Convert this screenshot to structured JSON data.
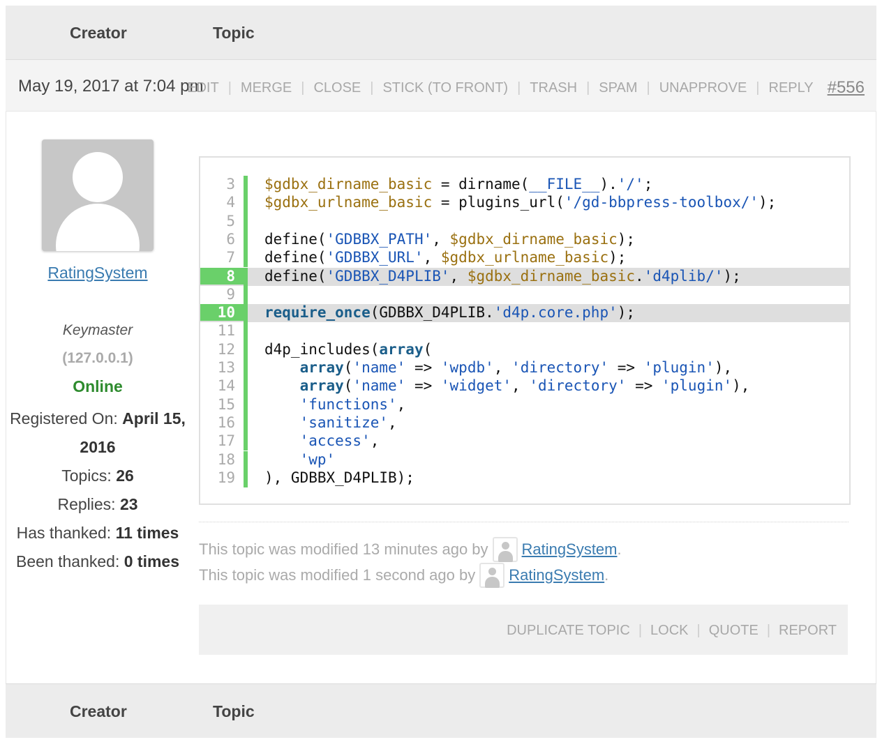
{
  "table_header": {
    "creator": "Creator",
    "topic": "Topic"
  },
  "post": {
    "date": "May 19, 2017 at 7:04 pm",
    "actions": [
      "EDIT",
      "MERGE",
      "CLOSE",
      "STICK (TO FRONT)",
      "TRASH",
      "SPAM",
      "UNAPPROVE",
      "REPLY"
    ],
    "separator": "|",
    "post_number": "#556"
  },
  "author": {
    "name": "RatingSystem",
    "role": "Keymaster",
    "ip": "(127.0.0.1)",
    "status": "Online",
    "registered_label": "Registered On:",
    "registered_value": "April 15, 2016",
    "topics_label": "Topics:",
    "topics_value": "26",
    "replies_label": "Replies:",
    "replies_value": "23",
    "thanked_label": "Has thanked:",
    "thanked_value": "11 times",
    "been_thanked_label": "Been thanked:",
    "been_thanked_value": "0 times",
    "avatar_icon": "default-user-avatar-icon"
  },
  "code": {
    "lines": [
      {
        "num": "3",
        "highlight": false
      },
      {
        "num": "4",
        "highlight": false
      },
      {
        "num": "5",
        "highlight": false
      },
      {
        "num": "6",
        "highlight": false
      },
      {
        "num": "7",
        "highlight": false
      },
      {
        "num": "8",
        "highlight": true
      },
      {
        "num": "9",
        "highlight": false
      },
      {
        "num": "10",
        "highlight": true
      },
      {
        "num": "11",
        "highlight": false
      },
      {
        "num": "12",
        "highlight": false
      },
      {
        "num": "13",
        "highlight": false
      },
      {
        "num": "14",
        "highlight": false
      },
      {
        "num": "15",
        "highlight": false
      },
      {
        "num": "16",
        "highlight": false
      },
      {
        "num": "17",
        "highlight": false
      },
      {
        "num": "18",
        "highlight": false
      },
      {
        "num": "19",
        "highlight": false
      }
    ],
    "tokens": [
      [
        [
          "var",
          "$gdbx_dirname_basic"
        ],
        [
          "txt",
          " = dirname("
        ],
        [
          "const",
          "__FILE__"
        ],
        [
          "txt",
          ")."
        ],
        [
          "str",
          "'/'"
        ],
        [
          "txt",
          ";"
        ]
      ],
      [
        [
          "var",
          "$gdbx_urlname_basic"
        ],
        [
          "txt",
          " = plugins_url("
        ],
        [
          "str",
          "'/gd-bbpress-toolbox/'"
        ],
        [
          "txt",
          ");"
        ]
      ],
      [],
      [
        [
          "txt",
          "define("
        ],
        [
          "str",
          "'GDBBX_PATH'"
        ],
        [
          "txt",
          ", "
        ],
        [
          "var",
          "$gdbx_dirname_basic"
        ],
        [
          "txt",
          ");"
        ]
      ],
      [
        [
          "txt",
          "define("
        ],
        [
          "str",
          "'GDBBX_URL'"
        ],
        [
          "txt",
          ", "
        ],
        [
          "var",
          "$gdbx_urlname_basic"
        ],
        [
          "txt",
          ");"
        ]
      ],
      [
        [
          "txt",
          "define("
        ],
        [
          "str",
          "'GDBBX_D4PLIB'"
        ],
        [
          "txt",
          ", "
        ],
        [
          "var",
          "$gdbx_dirname_basic"
        ],
        [
          "txt",
          "."
        ],
        [
          "str",
          "'d4plib/'"
        ],
        [
          "txt",
          ");"
        ]
      ],
      [],
      [
        [
          "kw",
          "require_once"
        ],
        [
          "txt",
          "(GDBBX_D4PLIB."
        ],
        [
          "str",
          "'d4p.core.php'"
        ],
        [
          "txt",
          ");"
        ]
      ],
      [],
      [
        [
          "txt",
          "d4p_includes("
        ],
        [
          "kw",
          "array"
        ],
        [
          "txt",
          "("
        ]
      ],
      [
        [
          "txt",
          "    "
        ],
        [
          "kw",
          "array"
        ],
        [
          "txt",
          "("
        ],
        [
          "str",
          "'name'"
        ],
        [
          "txt",
          " => "
        ],
        [
          "str",
          "'wpdb'"
        ],
        [
          "txt",
          ", "
        ],
        [
          "str",
          "'directory'"
        ],
        [
          "txt",
          " => "
        ],
        [
          "str",
          "'plugin'"
        ],
        [
          "txt",
          "),"
        ]
      ],
      [
        [
          "txt",
          "    "
        ],
        [
          "kw",
          "array"
        ],
        [
          "txt",
          "("
        ],
        [
          "str",
          "'name'"
        ],
        [
          "txt",
          " => "
        ],
        [
          "str",
          "'widget'"
        ],
        [
          "txt",
          ", "
        ],
        [
          "str",
          "'directory'"
        ],
        [
          "txt",
          " => "
        ],
        [
          "str",
          "'plugin'"
        ],
        [
          "txt",
          "),"
        ]
      ],
      [
        [
          "txt",
          "    "
        ],
        [
          "str",
          "'functions'"
        ],
        [
          "txt",
          ","
        ]
      ],
      [
        [
          "txt",
          "    "
        ],
        [
          "str",
          "'sanitize'"
        ],
        [
          "txt",
          ","
        ]
      ],
      [
        [
          "txt",
          "    "
        ],
        [
          "str",
          "'access'"
        ],
        [
          "txt",
          ","
        ]
      ],
      [
        [
          "txt",
          "    "
        ],
        [
          "str",
          "'wp'"
        ]
      ],
      [
        [
          "txt",
          "), GDBBX_D4PLIB);"
        ]
      ]
    ]
  },
  "modifications": [
    {
      "prefix": "This topic was modified 13 minutes ago by",
      "user": "RatingSystem",
      "suffix": "."
    },
    {
      "prefix": "This topic was modified 1 second ago by",
      "user": "RatingSystem",
      "suffix": "."
    }
  ],
  "footer_actions": [
    "DUPLICATE TOPIC",
    "LOCK",
    "QUOTE",
    "REPORT"
  ],
  "colors": {
    "accent_green": "#6ad06a",
    "link_blue": "#3a7bb0",
    "online_green": "#2e8b2e"
  }
}
